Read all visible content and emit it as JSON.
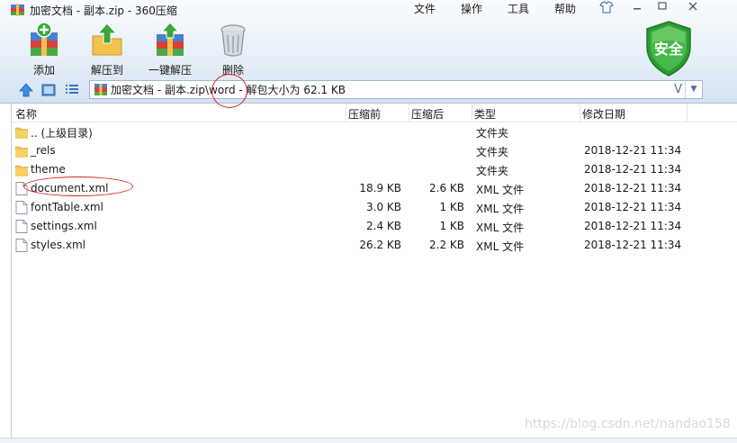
{
  "window": {
    "title": "加密文档 - 副本.zip - 360压缩",
    "menu": [
      "文件",
      "操作",
      "工具",
      "帮助"
    ]
  },
  "toolbar": {
    "add_label": "添加",
    "extract_to_label": "解压到",
    "one_click_label": "一键解压",
    "delete_label": "删除",
    "security_badge": "安全"
  },
  "address": {
    "path": "加密文档 - 副本.zip\\word - 解包大小为 62.1 KB",
    "dropdown_glyph": "V"
  },
  "file_list": {
    "columns": [
      "名称",
      "压缩前",
      "压缩后",
      "类型",
      "修改日期"
    ],
    "rows": [
      {
        "name": ".. (上级目录)",
        "size": "",
        "packed": "",
        "type": "文件夹",
        "date": "",
        "icon": "folder-icon"
      },
      {
        "name": "_rels",
        "size": "",
        "packed": "",
        "type": "文件夹",
        "date": "2018-12-21 11:34",
        "icon": "folder-icon"
      },
      {
        "name": "theme",
        "size": "",
        "packed": "",
        "type": "文件夹",
        "date": "2018-12-21 11:34",
        "icon": "folder-icon"
      },
      {
        "name": "document.xml",
        "size": "18.9 KB",
        "packed": "2.6 KB",
        "type": "XML 文件",
        "date": "2018-12-21 11:34",
        "icon": "file-icon"
      },
      {
        "name": "fontTable.xml",
        "size": "3.0 KB",
        "packed": "1 KB",
        "type": "XML 文件",
        "date": "2018-12-21 11:34",
        "icon": "file-icon"
      },
      {
        "name": "settings.xml",
        "size": "2.4 KB",
        "packed": "1 KB",
        "type": "XML 文件",
        "date": "2018-12-21 11:34",
        "icon": "file-icon"
      },
      {
        "name": "styles.xml",
        "size": "26.2 KB",
        "packed": "2.2 KB",
        "type": "XML 文件",
        "date": "2018-12-21 11:34",
        "icon": "file-icon"
      }
    ]
  },
  "watermark": "https://blog.csdn.net/nandao158",
  "colors": {
    "accent_blue": "#3a73c4",
    "folder": "#f2c24c",
    "shield_green": "#39a83a",
    "annotation_red": "#e02020"
  }
}
